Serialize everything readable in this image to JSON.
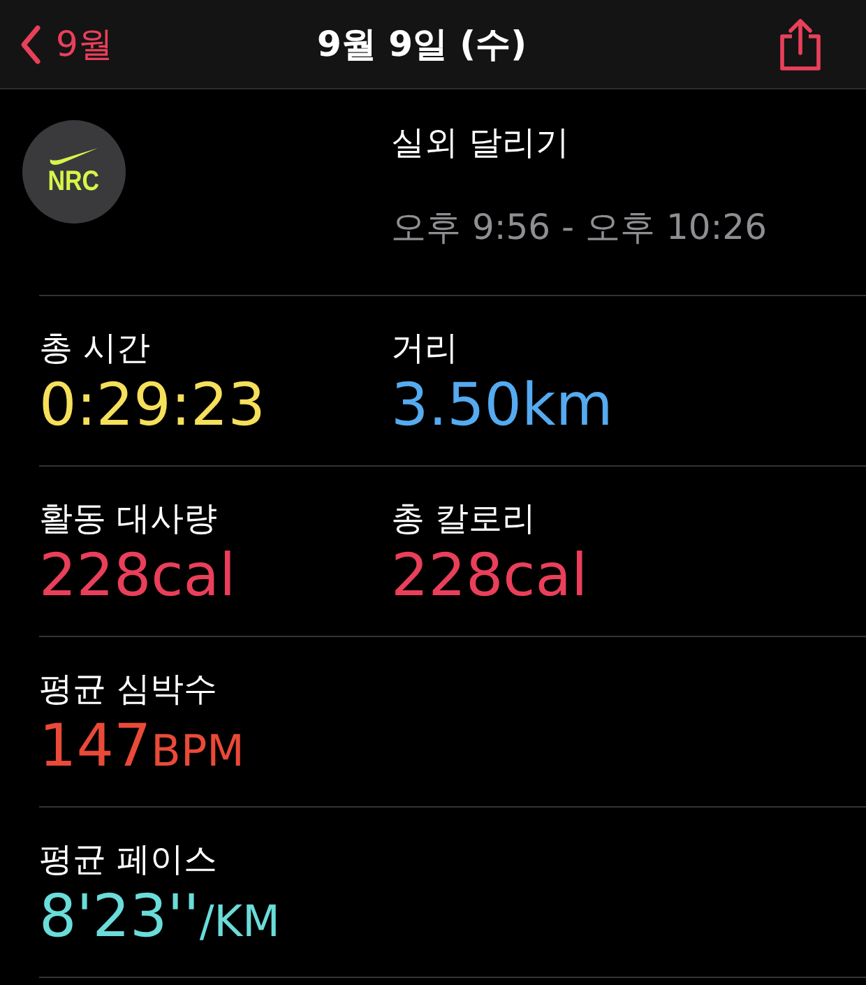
{
  "nav": {
    "back_label": "9월",
    "title": "9월 9일 (수)"
  },
  "workout": {
    "app_badge": "NRC",
    "name": "실외 달리기",
    "time_range": "오후 9:56 - 오후 10:26"
  },
  "rows": [
    [
      {
        "label": "총 시간",
        "value": "0:29:23",
        "color": "#f5df5b"
      },
      {
        "label": "거리",
        "value": "3.50km",
        "color": "#55aaf0"
      }
    ],
    [
      {
        "label": "활동 대사량",
        "value": "228cal",
        "color": "#ea3f5a"
      },
      {
        "label": "총 칼로리",
        "value": "228cal",
        "color": "#ea3f5a"
      }
    ],
    [
      {
        "label": "평균 심박수",
        "value": "147",
        "unit": "BPM",
        "color": "#ea4a38"
      }
    ],
    [
      {
        "label": "평균 페이스",
        "value": "8'23''",
        "unit": "/KM",
        "color": "#6adcd9"
      }
    ]
  ]
}
